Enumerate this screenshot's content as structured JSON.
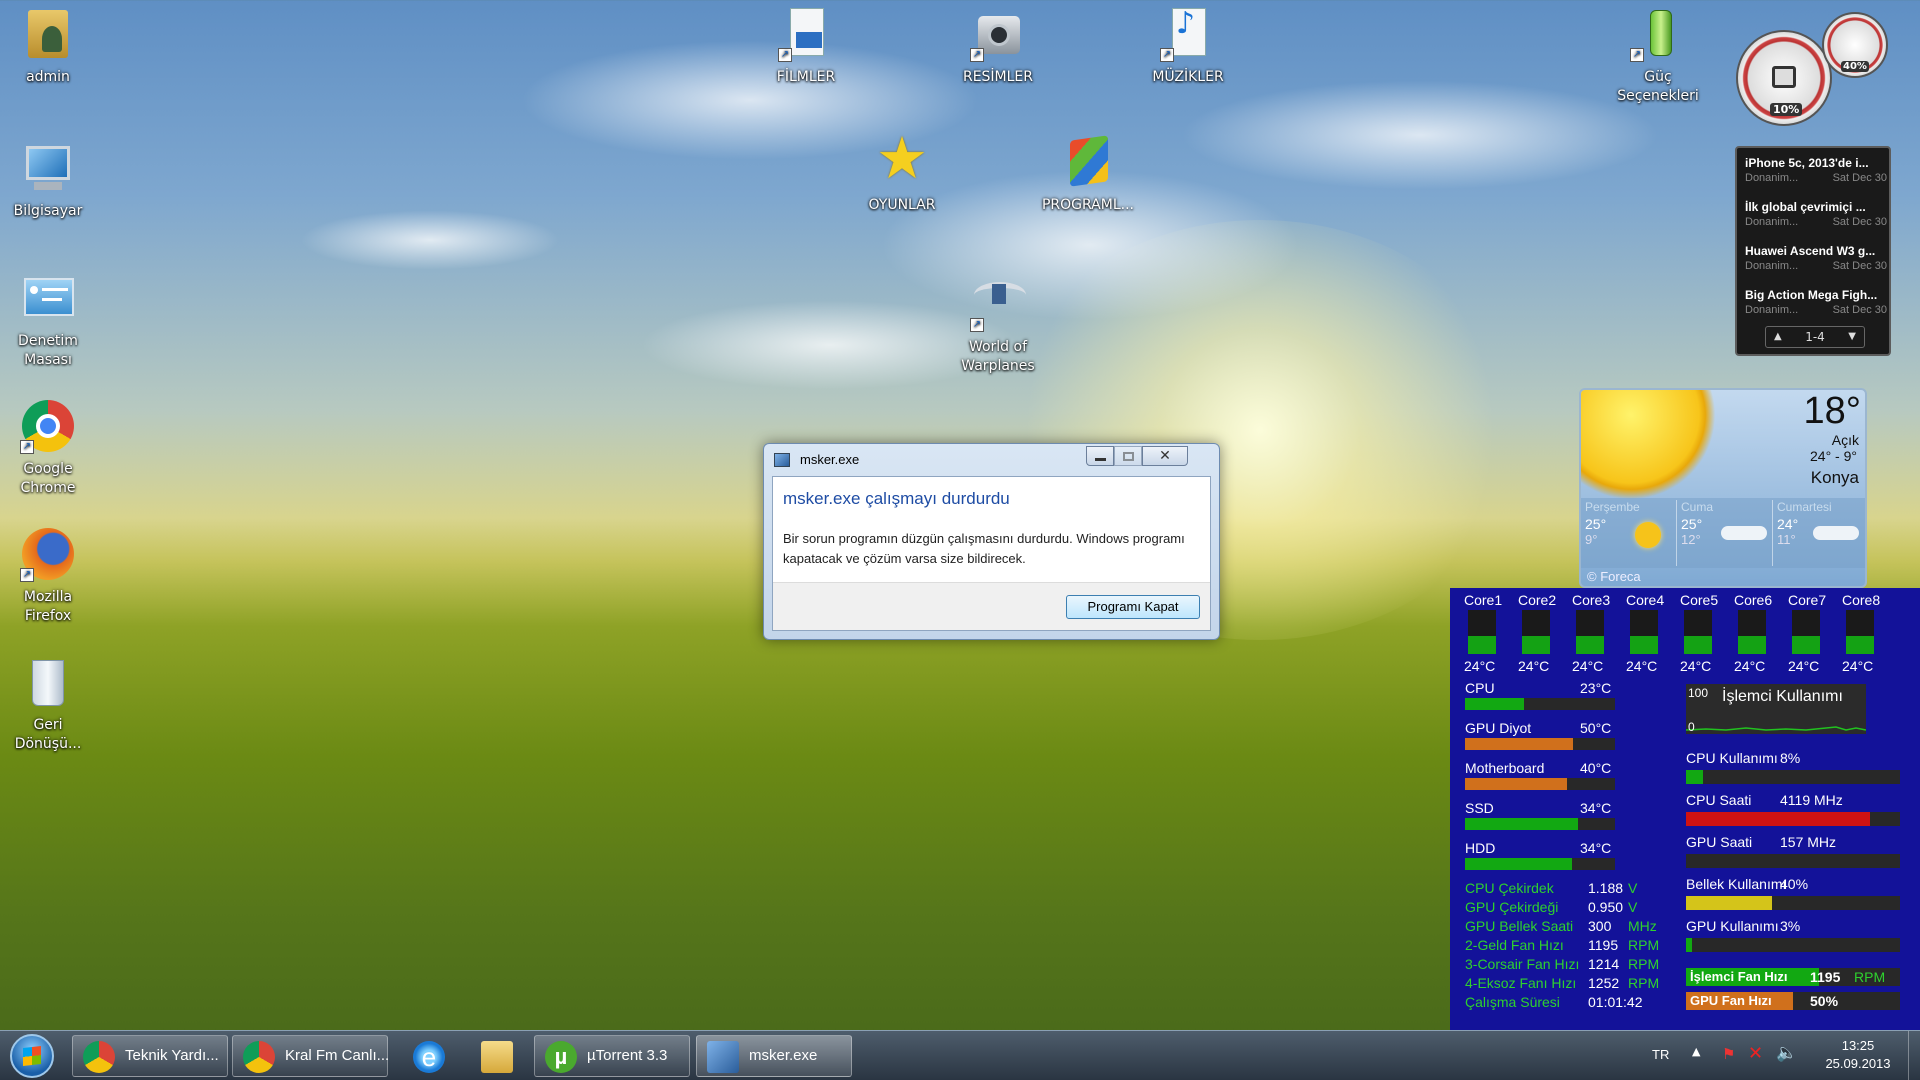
{
  "desktop_icons": {
    "admin": "admin",
    "computer": "Bilgisayar",
    "control_panel": "Denetim Masası",
    "chrome": "Google Chrome",
    "firefox": "Mozilla Firefox",
    "recycle": "Geri Dönüşü...",
    "films": "FİLMLER",
    "pictures": "RESİMLER",
    "music": "MÜZİKLER",
    "games": "OYUNLAR",
    "programs": "PROGRAML...",
    "warplanes": "World of Warplanes",
    "power": "Güç Seçenekleri"
  },
  "gauges": {
    "left_value": "10%",
    "right_value": "40%"
  },
  "news": {
    "items": [
      {
        "title": "iPhone 5c, 2013'de i...",
        "source": "Donanim...",
        "date": "Sat Dec 30"
      },
      {
        "title": "İlk global çevrimiçi ...",
        "source": "Donanim...",
        "date": "Sat Dec 30"
      },
      {
        "title": "Huawei Ascend W3 g...",
        "source": "Donanim...",
        "date": "Sat Dec 30"
      },
      {
        "title": "Big Action Mega Figh...",
        "source": "Donanim...",
        "date": "Sat Dec 30"
      }
    ],
    "pager": "1-4"
  },
  "weather": {
    "temp": "18°",
    "condition": "Açık",
    "range": "24° - 9°",
    "city": "Konya",
    "credit": "© Foreca",
    "forecast": [
      {
        "day": "Perşembe",
        "high": "25°",
        "low": "9°"
      },
      {
        "day": "Cuma",
        "high": "25°",
        "low": "12°"
      },
      {
        "day": "Cumartesi",
        "high": "24°",
        "low": "11°"
      }
    ]
  },
  "dialog": {
    "title": "msker.exe",
    "heading": "msker.exe çalışmayı durdurdu",
    "body": "Bir sorun programın düzgün çalışmasını durdurdu. Windows programı kapatacak ve çözüm varsa size bildirecek.",
    "button": "Programı Kapat"
  },
  "monitor": {
    "cores": [
      {
        "name": "Core1",
        "temp": "24°C"
      },
      {
        "name": "Core2",
        "temp": "24°C"
      },
      {
        "name": "Core3",
        "temp": "24°C"
      },
      {
        "name": "Core4",
        "temp": "24°C"
      },
      {
        "name": "Core5",
        "temp": "24°C"
      },
      {
        "name": "Core6",
        "temp": "24°C"
      },
      {
        "name": "Core7",
        "temp": "24°C"
      },
      {
        "name": "Core8",
        "temp": "24°C"
      }
    ],
    "sensors": [
      {
        "name": "CPU",
        "value": "23°C",
        "level": 0.39,
        "color": "#12a812"
      },
      {
        "name": "GPU Diyot",
        "value": "50°C",
        "level": 0.72,
        "color": "#d0701c"
      },
      {
        "name": "Motherboard",
        "value": "40°C",
        "level": 0.68,
        "color": "#d0701c"
      },
      {
        "name": "SSD",
        "value": "34°C",
        "level": 0.75,
        "color": "#12a812"
      },
      {
        "name": "HDD",
        "value": "34°C",
        "level": 0.71,
        "color": "#12a812"
      }
    ],
    "details": [
      {
        "name": "CPU Çekirdek",
        "value": "1.188",
        "unit": "V"
      },
      {
        "name": "GPU Çekirdeği",
        "value": "0.950",
        "unit": "V"
      },
      {
        "name": "GPU Bellek Saati",
        "value": "300",
        "unit": "MHz"
      },
      {
        "name": "2-Geld Fan Hızı",
        "value": "1195",
        "unit": "RPM"
      },
      {
        "name": "3-Corsair Fan Hızı",
        "value": "1214",
        "unit": "RPM"
      },
      {
        "name": "4-Eksoz Fanı Hızı",
        "value": "1252",
        "unit": "RPM"
      },
      {
        "name": "Çalışma Süresi",
        "value": "01:01:42",
        "unit": ""
      }
    ],
    "graph": {
      "title": "İşlemci Kullanımı",
      "max": "100",
      "min": "0"
    },
    "stats": [
      {
        "name": "CPU Kullanımı",
        "value": "8%",
        "level": 0.08,
        "color": "#12a812"
      },
      {
        "name": "CPU Saati",
        "value": "4119 MHz",
        "level": 0.86,
        "color": "#d01212"
      },
      {
        "name": "GPU Saati",
        "value": "157 MHz",
        "level": 0.0,
        "color": "#12a812"
      },
      {
        "name": "Bellek Kullanımı",
        "value": "40%",
        "level": 0.4,
        "color": "#d4c41a"
      },
      {
        "name": "GPU Kullanımı",
        "value": "3%",
        "level": 0.03,
        "color": "#12a812"
      }
    ],
    "fans": [
      {
        "name": "İşlemci Fan Hızı",
        "value": "1195",
        "unit": "RPM",
        "level": 0.62,
        "color": "#12a812"
      },
      {
        "name": "GPU Fan Hızı",
        "value": "50%",
        "unit": "",
        "level": 0.5,
        "color": "#d0701c"
      }
    ]
  },
  "taskbar": {
    "buttons": [
      {
        "label": "Teknik Yardı..."
      },
      {
        "label": "Kral Fm Canlı..."
      },
      {
        "label": ""
      },
      {
        "label": ""
      },
      {
        "label": "µTorrent 3.3"
      },
      {
        "label": "msker.exe"
      }
    ],
    "lang": "TR",
    "time": "13:25",
    "date": "25.09.2013"
  }
}
